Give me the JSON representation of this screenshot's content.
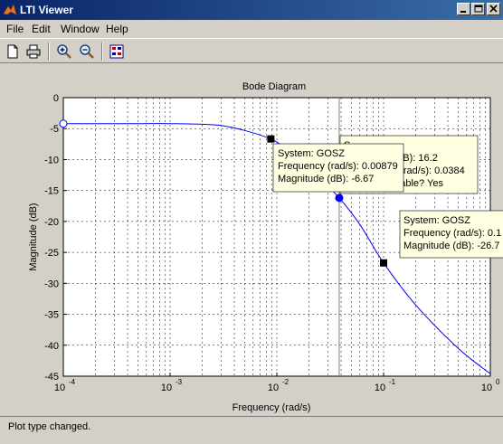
{
  "window": {
    "title": "LTI Viewer",
    "icon": "matlab-logo-icon"
  },
  "menu": [
    "File",
    "Edit",
    "Window",
    "Help"
  ],
  "toolbar": {
    "buttons": [
      "new-document-icon",
      "print-icon",
      "zoom-in-icon",
      "zoom-out-icon",
      "grid-layout-icon"
    ]
  },
  "plot": {
    "title": "Bode Diagram",
    "xlabel": "Frequency  (rad/s)",
    "ylabel": "Magnitude (dB)",
    "x_ticks": [
      {
        "base": "10",
        "exp": "-4"
      },
      {
        "base": "10",
        "exp": "-3"
      },
      {
        "base": "10",
        "exp": "-2"
      },
      {
        "base": "10",
        "exp": "-1"
      },
      {
        "base": "10",
        "exp": "0"
      }
    ],
    "y_ticks": [
      "0",
      "-5",
      "-10",
      "-15",
      "-20",
      "-25",
      "-30",
      "-35",
      "-40",
      "-45"
    ],
    "datatips": [
      {
        "lines": [
          "System: GOSZ",
          "Frequency (rad/s): 0.00879",
          "Magnitude (dB): -6.67"
        ]
      },
      {
        "lines": [
          "System: GOSZ",
          "Frequency (rad/s): 0.1",
          "Magnitude (dB): -26.7"
        ]
      },
      {
        "lines": [
          "S...",
          "...dB): 16.2",
          "... (rad/s): 0.0384",
          "...table? Yes"
        ]
      }
    ]
  },
  "chart_data": {
    "type": "line",
    "title": "Bode Diagram",
    "xlabel": "Frequency  (rad/s)",
    "ylabel": "Magnitude (dB)",
    "x_scale": "log",
    "xlim": [
      0.0001,
      1
    ],
    "ylim": [
      -45,
      0
    ],
    "grid": true,
    "series": [
      {
        "name": "GOSZ",
        "x": [
          0.0001,
          0.0002,
          0.0005,
          0.001,
          0.002,
          0.003,
          0.005,
          0.00879,
          0.012,
          0.02,
          0.0384,
          0.06,
          0.1,
          0.2,
          0.5,
          1
        ],
        "y": [
          -4.2,
          -4.2,
          -4.2,
          -4.2,
          -4.3,
          -4.5,
          -5.3,
          -6.67,
          -8.2,
          -11.3,
          -16.2,
          -20.5,
          -26.7,
          -33.5,
          -40.5,
          -44.6
        ],
        "color": "#0000ff"
      }
    ],
    "markers": [
      {
        "x": 0.0001,
        "y": -4.2,
        "style": "open-circle"
      },
      {
        "x": 0.00879,
        "y": -6.67,
        "style": "black-square"
      },
      {
        "x": 0.0384,
        "y": -16.2,
        "style": "blue-dot"
      },
      {
        "x": 0.1,
        "y": -26.7,
        "style": "black-square"
      }
    ]
  },
  "status": {
    "text": "Plot type changed."
  }
}
